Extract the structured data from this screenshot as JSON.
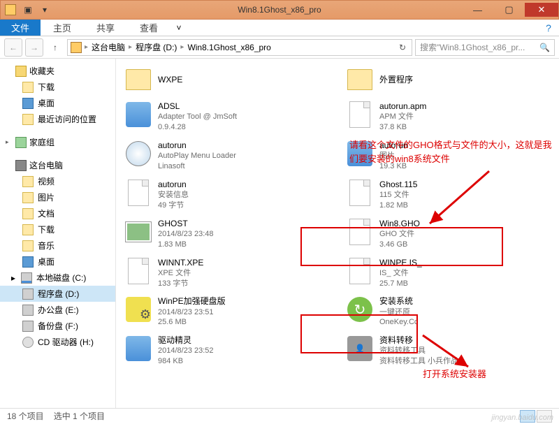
{
  "window": {
    "title": "Win8.1Ghost_x86_pro"
  },
  "ribbon": {
    "file": "文件",
    "tabs": [
      "主页",
      "共享",
      "查看"
    ]
  },
  "breadcrumb": {
    "parts": [
      "这台电脑",
      "程序盘 (D:)",
      "Win8.1Ghost_x86_pro"
    ]
  },
  "search": {
    "placeholder": "搜索\"Win8.1Ghost_x86_pr..."
  },
  "sidebar": {
    "favorites": {
      "label": "收藏夹",
      "items": [
        "下载",
        "桌面",
        "最近访问的位置"
      ]
    },
    "homegroup": {
      "label": "家庭组"
    },
    "thispc": {
      "label": "这台电脑",
      "items": [
        "视频",
        "图片",
        "文档",
        "下载",
        "音乐",
        "桌面",
        "本地磁盘 (C:)",
        "程序盘 (D:)",
        "办公盘 (E:)",
        "备份盘 (F:)",
        "CD 驱动器 (H:)"
      ]
    }
  },
  "files": {
    "left": [
      {
        "name": "WXPE",
        "line2": "",
        "line3": "",
        "icon": "folder"
      },
      {
        "name": "ADSL",
        "line2": "Adapter Tool @ JmSoft",
        "line3": "0.9.4.28",
        "icon": "exe"
      },
      {
        "name": "autorun",
        "line2": "AutoPlay Menu Loader",
        "line3": "Linasoft",
        "icon": "cd"
      },
      {
        "name": "autorun",
        "line2": "安装信息",
        "line3": "49 字节",
        "icon": "file"
      },
      {
        "name": "GHOST",
        "line2": "2014/8/23 23:48",
        "line3": "1.83 MB",
        "icon": "img"
      },
      {
        "name": "WINNT.XPE",
        "line2": "XPE 文件",
        "line3": "133 字节",
        "icon": "file"
      },
      {
        "name": "WinPE加强硬盘版",
        "line2": "2014/8/23 23:51",
        "line3": "25.6 MB",
        "icon": "gear"
      },
      {
        "name": "驱动精灵",
        "line2": "2014/8/23 23:52",
        "line3": "984 KB",
        "icon": "exe"
      }
    ],
    "right": [
      {
        "name": "外置程序",
        "line2": "",
        "line3": "",
        "icon": "folder"
      },
      {
        "name": "autorun.apm",
        "line2": "APM 文件",
        "line3": "37.8 KB",
        "icon": "file"
      },
      {
        "name": "autorun",
        "line2": "图片",
        "line3": "19.3 KB",
        "icon": "exe"
      },
      {
        "name": "Ghost.115",
        "line2": "115 文件",
        "line3": "1.82 MB",
        "icon": "file"
      },
      {
        "name": "Win8.GHO",
        "line2": "GHO 文件",
        "line3": "3.46 GB",
        "icon": "file"
      },
      {
        "name": "WINPE.IS_",
        "line2": "IS_ 文件",
        "line3": "25.7 MB",
        "icon": "file"
      },
      {
        "name": "安装系统",
        "line2": "一键还原",
        "line3": "OneKey.Cc",
        "icon": "green"
      },
      {
        "name": "资料转移",
        "line2": "资料转移工具",
        "line3": "资料转移工具 小兵作品",
        "icon": "gray"
      }
    ]
  },
  "status": {
    "count": "18 个项目",
    "selected": "选中 1 个项目"
  },
  "annotations": {
    "top": "请看这个文件的GHO格式与文件的大小，这就是我们要安装的win8系统文件",
    "bottom": "打开系统安装器"
  },
  "watermark": "jingyan.baidu.com"
}
